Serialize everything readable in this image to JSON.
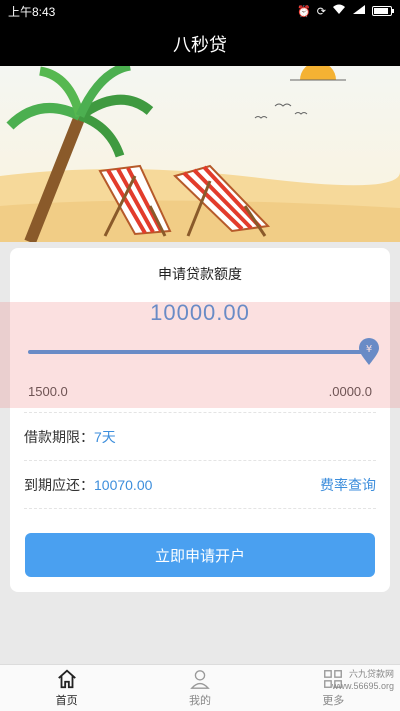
{
  "status_bar": {
    "time": "上午8:43"
  },
  "header": {
    "title": "八秒贷"
  },
  "card": {
    "title": "申请贷款额度",
    "amount": "10000.00",
    "slider": {
      "min_label": "1500.0",
      "max_label": ".0000.0",
      "level": 1.0
    },
    "term_label": "借款期限：",
    "term_value": "7天",
    "due_label": "到期应还：",
    "due_value": "10070.00",
    "rate_link": "费率查询",
    "apply_button": "立即申请开户"
  },
  "tabs": [
    {
      "label": "首页",
      "icon": "home-icon",
      "active": true
    },
    {
      "label": "我的",
      "icon": "user-icon",
      "active": false
    },
    {
      "label": "更多",
      "icon": "grid-icon",
      "active": false
    }
  ],
  "watermark": {
    "line1": "六九贷款网",
    "line2": "www.56695.org"
  },
  "colors": {
    "accent": "#3d8edc",
    "button": "#4aa0f0",
    "header_bg": "#000000"
  }
}
